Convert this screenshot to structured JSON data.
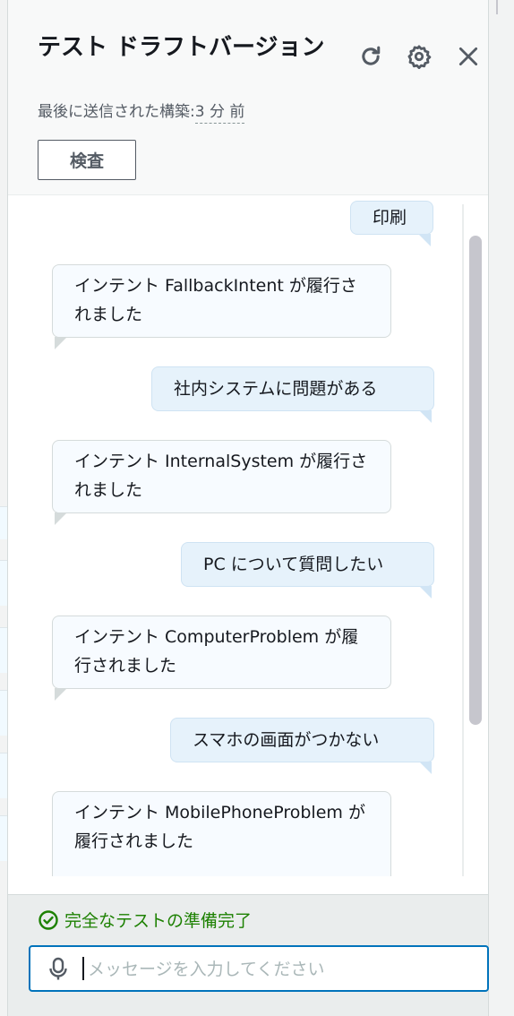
{
  "header": {
    "title": "テスト ドラフトバージョン",
    "subtitle_label": "最後に送信された構築:",
    "subtitle_value": "3 分 前",
    "inspect_label": "検査",
    "refresh_icon": "refresh-icon",
    "settings_icon": "gear-icon",
    "close_icon": "close-icon"
  },
  "messages": [
    {
      "role": "user",
      "text": "印刷"
    },
    {
      "role": "bot",
      "text": "インテント FallbackIntent が履行されました"
    },
    {
      "role": "user",
      "text": "社内システムに問題がある"
    },
    {
      "role": "bot",
      "text": "インテント InternalSystem が履行されました"
    },
    {
      "role": "user",
      "text": "PC について質問したい"
    },
    {
      "role": "bot",
      "text": "インテント ComputerProblem が履行されました"
    },
    {
      "role": "user",
      "text": "スマホの画面がつかない"
    },
    {
      "role": "bot",
      "text": "インテント MobilePhoneProblem が履行されました"
    }
  ],
  "footer": {
    "status_text": "完全なテストの準備完了",
    "status_icon": "check-circle-icon",
    "input_placeholder": "メッセージを入力してください",
    "input_value": "",
    "mic_icon": "microphone-icon"
  },
  "colors": {
    "accent": "#0073bb",
    "success": "#1d8102",
    "user_bubble": "#e6f2fb",
    "bot_bubble": "#f7fbff"
  }
}
